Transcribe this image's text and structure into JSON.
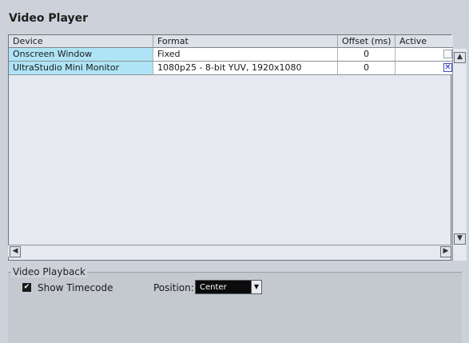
{
  "title": "Video Player",
  "table": {
    "columns": [
      "Device",
      "Format",
      "Offset (ms)",
      "Active"
    ],
    "rows": [
      {
        "device": "Onscreen Window",
        "format": "Fixed",
        "offset": "0",
        "active": false
      },
      {
        "device": "UltraStudio Mini Monitor",
        "format": "1080p25 - 8-bit YUV, 1920x1080",
        "offset": "0",
        "active": true
      }
    ]
  },
  "playback": {
    "group_label": "Video Playback",
    "show_timecode_label": "Show Timecode",
    "show_timecode_checked": true,
    "position_label": "Position:",
    "position_value": "Center"
  },
  "icons": {
    "scroll_up": "chevron-up-icon",
    "scroll_down": "chevron-down-icon",
    "scroll_left": "chevron-left-icon",
    "scroll_right": "chevron-right-icon",
    "dropdown": "chevron-down-icon"
  },
  "colors": {
    "device_cell": "#aee4f5",
    "active_check": "#1a2db5"
  }
}
